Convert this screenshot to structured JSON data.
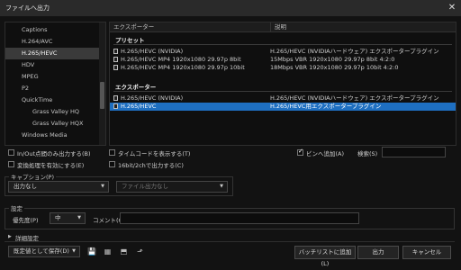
{
  "window": {
    "title": "ファイルへ出力",
    "close": "✕"
  },
  "formats": [
    {
      "label": "Captions",
      "sub": false
    },
    {
      "label": "H.264/AVC",
      "sub": false
    },
    {
      "label": "H.265/HEVC",
      "sub": false,
      "selected": true
    },
    {
      "label": "HDV",
      "sub": false
    },
    {
      "label": "MPEG",
      "sub": false
    },
    {
      "label": "P2",
      "sub": false
    },
    {
      "label": "QuickTime",
      "sub": false
    },
    {
      "label": "Grass Valley HQ",
      "sub": true
    },
    {
      "label": "Grass Valley HQX",
      "sub": true
    },
    {
      "label": "Windows Media",
      "sub": false
    }
  ],
  "preset_table": {
    "col_exporter": "エクスポーター",
    "col_desc": "説明",
    "section_preset": "プリセット",
    "section_exporter": "エクスポーター",
    "presets": [
      {
        "name": "H.265/HEVC (NVIDIA)",
        "desc": "H.265/HEVC (NVIDIAハードウェア) エクスポータープラグイン"
      },
      {
        "name": "H.265/HEVC MP4 1920x1080 29.97p 8bit",
        "desc": "15Mbps VBR 1920x1080 29.97p 8bit 4:2:0"
      },
      {
        "name": "H.265/HEVC MP4 1920x1080 29.97p 10bit",
        "desc": "18Mbps VBR 1920x1080 29.97p 10bit 4:2:0"
      }
    ],
    "exporters": [
      {
        "name": "H.265/HEVC (NVIDIA)",
        "desc": "H.265/HEVC (NVIDIAハードウェア) エクスポータープラグイン",
        "selected": false
      },
      {
        "name": "H.265/HEVC",
        "desc": "H.265/HEVC用エクスポータープラグイン",
        "selected": true
      }
    ]
  },
  "options": {
    "inout": "In/Out点間のみ出力する(B)",
    "convert": "変換処理を有効にする(E)",
    "timecode": "タイムコードを表示する(T)",
    "sixteenbit": "16bit/2chで出力する(C)",
    "add_bin": "ビンへ追加(A)",
    "add_bin_checked": true,
    "search_label": "検索(S)",
    "search_value": ""
  },
  "caption": {
    "group_title": "キャプション(P)",
    "output_value": "出力なし",
    "file_value": "ファイル出力なし"
  },
  "settings": {
    "group_title": "設定",
    "priority_label": "優先度(P)",
    "priority_value": "中",
    "comment_label": "コメント(C)",
    "comment_value": ""
  },
  "detail_label": "詳細設定",
  "footer": {
    "save_default": "既定値として保存(D)",
    "batch": "バッチリストに追加(L)",
    "output": "出力",
    "cancel": "キャンセル"
  }
}
